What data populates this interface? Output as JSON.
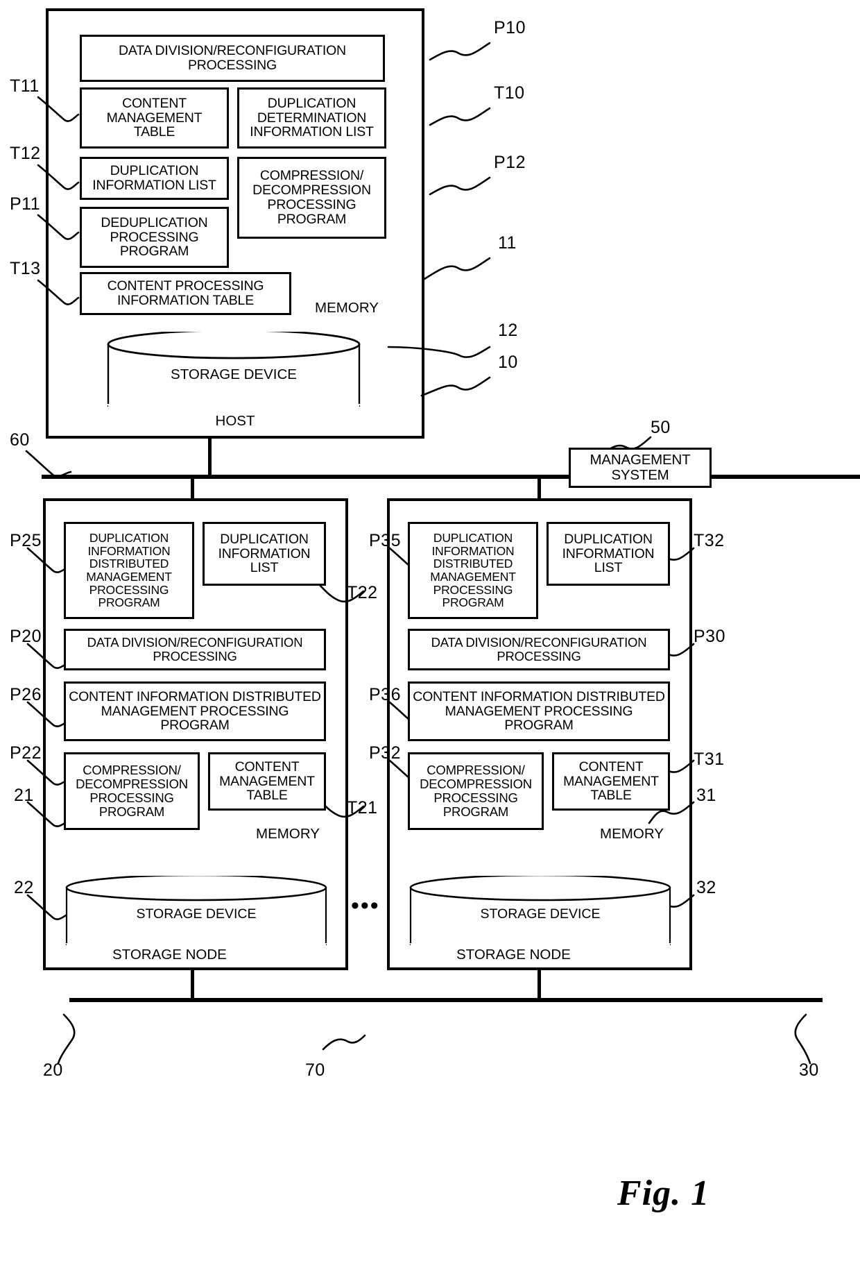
{
  "figure": {
    "caption": "Fig. 1"
  },
  "host": {
    "label": "HOST",
    "ref": "10",
    "memory": {
      "label": "MEMORY",
      "ref": "11"
    },
    "storage_device": {
      "label": "STORAGE DEVICE",
      "ref": "12"
    },
    "blocks": [
      {
        "id": "P10",
        "text": "DATA DIVISION/RECONFIGURATION PROCESSING"
      },
      {
        "id": "T11",
        "text": "CONTENT MANAGEMENT TABLE"
      },
      {
        "id": "T10",
        "text": "DUPLICATION DETERMINATION INFORMATION LIST"
      },
      {
        "id": "T12",
        "text": "DUPLICATION INFORMATION LIST"
      },
      {
        "id": "P12",
        "text": "COMPRESSION/ DECOMPRESSION PROCESSING PROGRAM"
      },
      {
        "id": "P11",
        "text": "DEDUPLICATION PROCESSING PROGRAM"
      },
      {
        "id": "T13",
        "text": "CONTENT PROCESSING INFORMATION TABLE"
      }
    ],
    "block_text": {
      "data_division": "DATA DIVISION/RECONFIGURATION PROCESSING",
      "content_management_table": "CONTENT MANAGEMENT TABLE",
      "duplication_determination_list": "DUPLICATION DETERMINATION INFORMATION LIST",
      "duplication_information_list": "DUPLICATION INFORMATION LIST",
      "compression_decompression": "COMPRESSION/ DECOMPRESSION PROCESSING PROGRAM",
      "deduplication_program": "DEDUPLICATION PROCESSING PROGRAM",
      "content_processing_table": "CONTENT PROCESSING INFORMATION TABLE"
    }
  },
  "management_system": {
    "label": "MANAGEMENT SYSTEM",
    "ref": "50"
  },
  "networks": {
    "upper_ref": "60",
    "lower_ref": "70"
  },
  "storage_node_left": {
    "label": "STORAGE NODE",
    "ref": "20",
    "memory": {
      "label": "MEMORY",
      "ref": "21"
    },
    "storage_device": {
      "label": "STORAGE DEVICE",
      "ref": "22"
    },
    "block_text": {
      "duplication_info_dist_mgmt": "DUPLICATION INFORMATION DISTRIBUTED MANAGEMENT PROCESSING PROGRAM",
      "duplication_information_list": "DUPLICATION INFORMATION LIST",
      "data_division": "DATA DIVISION/RECONFIGURATION PROCESSING",
      "content_info_dist_mgmt": "CONTENT INFORMATION DISTRIBUTED MANAGEMENT PROCESSING PROGRAM",
      "compression_decompression": "COMPRESSION/ DECOMPRESSION PROCESSING PROGRAM",
      "content_management_table": "CONTENT MANAGEMENT TABLE"
    },
    "refs": {
      "duplication_info_dist_mgmt": "P25",
      "duplication_information_list": "T22",
      "data_division": "P20",
      "content_info_dist_mgmt": "P26",
      "compression_decompression": "P22",
      "content_management_table": "T21"
    }
  },
  "storage_node_right": {
    "label": "STORAGE NODE",
    "ref": "30",
    "memory": {
      "label": "MEMORY",
      "ref": "31"
    },
    "storage_device": {
      "label": "STORAGE DEVICE",
      "ref": "32"
    },
    "block_text": {
      "duplication_info_dist_mgmt": "DUPLICATION INFORMATION DISTRIBUTED MANAGEMENT PROCESSING PROGRAM",
      "duplication_information_list": "DUPLICATION INFORMATION LIST",
      "data_division": "DATA DIVISION/RECONFIGURATION PROCESSING",
      "content_info_dist_mgmt": "CONTENT INFORMATION DISTRIBUTED MANAGEMENT PROCESSING PROGRAM",
      "compression_decompression": "COMPRESSION/ DECOMPRESSION PROCESSING PROGRAM",
      "content_management_table": "CONTENT MANAGEMENT TABLE"
    },
    "refs": {
      "duplication_info_dist_mgmt": "P35",
      "duplication_information_list": "T32",
      "data_division": "P30",
      "content_info_dist_mgmt": "P36",
      "compression_decompression": "P32",
      "content_management_table": "T31"
    }
  },
  "continuation": {
    "symbol": "•••"
  }
}
